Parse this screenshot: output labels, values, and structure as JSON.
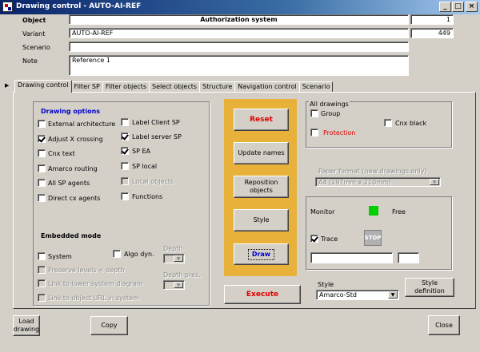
{
  "window": {
    "title": "Drawing control - AUTO-AI-REF"
  },
  "header": {
    "object_label": "Object",
    "object_value": "Authorization system",
    "object_count": "1",
    "variant_label": "Variant",
    "variant_value": "AUTO-AI-REF",
    "variant_count": "449",
    "scenario_label": "Scenario",
    "scenario_value": "",
    "note_label": "Note",
    "note_value": "Reference 1"
  },
  "tabs": [
    {
      "label": "Drawing control"
    },
    {
      "label": "Filter SP"
    },
    {
      "label": "Filter objects"
    },
    {
      "label": "Select objects"
    },
    {
      "label": "Structure"
    },
    {
      "label": "Navigation control"
    },
    {
      "label": "Scenario"
    }
  ],
  "drawing_options": {
    "title": "Drawing options",
    "left": [
      {
        "label": "External architecture",
        "checked": false
      },
      {
        "label": "Adjust X crossing",
        "checked": true
      },
      {
        "label": "Cnx text",
        "checked": false
      },
      {
        "label": "Amarco routing",
        "checked": false
      },
      {
        "label": "All SP agents",
        "checked": false
      },
      {
        "label": "Direct cx agents",
        "checked": false
      }
    ],
    "right": [
      {
        "label": "Label Client SP",
        "checked": false
      },
      {
        "label": "Label server SP",
        "checked": true
      },
      {
        "label": "SP EA",
        "checked": true
      },
      {
        "label": "SP local",
        "checked": false
      },
      {
        "label": "Local objects",
        "checked": false,
        "disabled": true
      },
      {
        "label": "Functions",
        "checked": false
      }
    ]
  },
  "embedded": {
    "title": "Embedded mode",
    "system_label": "System",
    "algo_label": "Algo dyn.",
    "depth_label": "Depth",
    "depth_pres_label": "Depth pres.",
    "preserve_label": "Preserve levels < depth",
    "link_lower_label": "Link to lower system diagram",
    "link_url_label": "Link to object URL in system"
  },
  "actions": {
    "reset": "Reset",
    "update_names": "Update names",
    "reposition": "Reposition objects",
    "style": "Style",
    "draw": "Draw",
    "execute": "Execute"
  },
  "all_drawings": {
    "title": "All drawings",
    "group_label": "Group",
    "cnx_black_label": "Cnx black",
    "protection_label": "Protection",
    "paper_format_label": "Paper format (new drawings only)",
    "paper_format_value": "A4 (297mm x 210mm)"
  },
  "monitor": {
    "label": "Monitor",
    "status": "Free",
    "status_color": "#00d000",
    "trace_label": "Trace",
    "trace_checked": true,
    "stop_label": "STOP"
  },
  "style": {
    "label": "Style",
    "value": "Amarco-Std",
    "definition_button": "Style definition"
  },
  "footer": {
    "load_drawing": "Load drawing",
    "copy": "Copy",
    "close": "Close"
  }
}
